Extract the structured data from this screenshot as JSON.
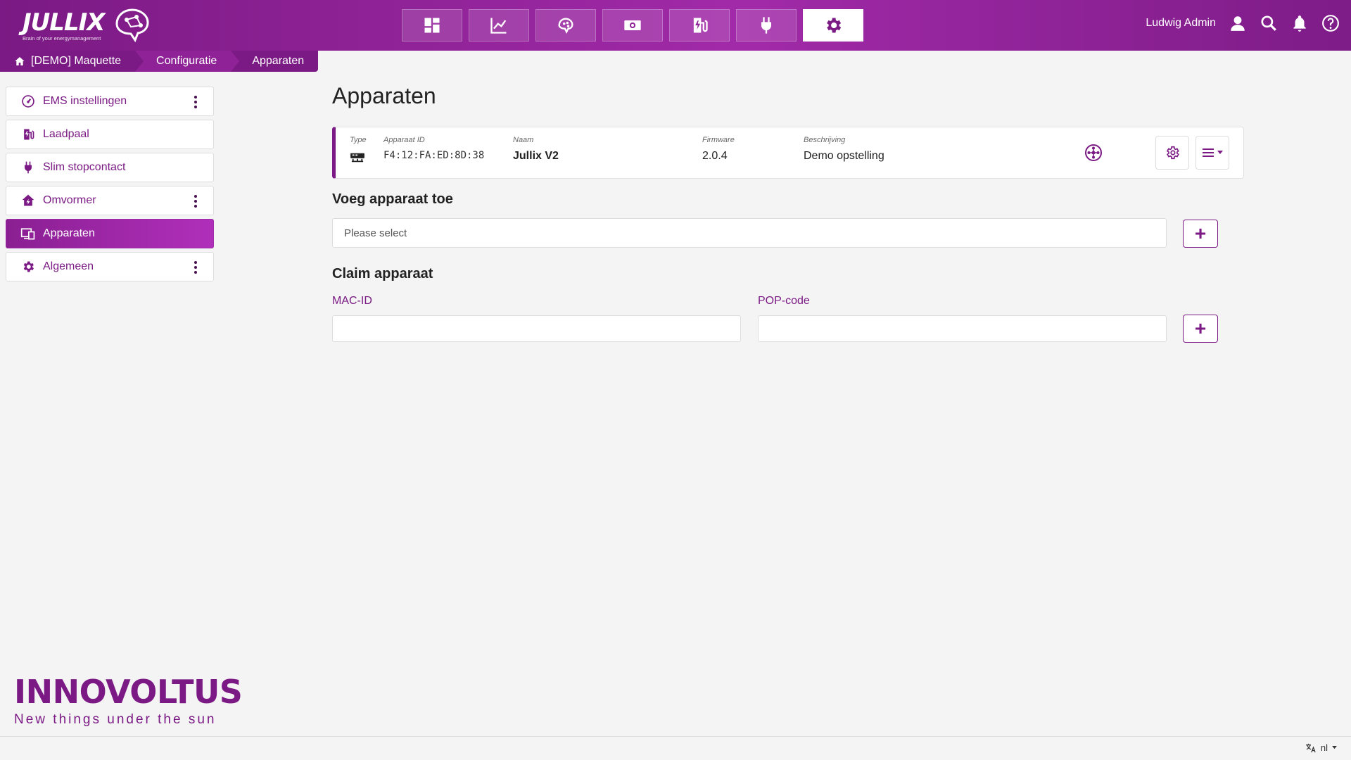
{
  "app": {
    "brand": "JULLIX",
    "tagline": "Brain of your energymanagement",
    "accent": "#7b1a84"
  },
  "topnav": [
    {
      "icon": "dashboard-icon",
      "active": false
    },
    {
      "icon": "chart-line-icon",
      "active": false
    },
    {
      "icon": "brain-icon",
      "active": false
    },
    {
      "icon": "money-icon",
      "active": false
    },
    {
      "icon": "ev-charger-icon",
      "active": false
    },
    {
      "icon": "plug-icon",
      "active": false
    },
    {
      "icon": "gear-icon",
      "active": true
    }
  ],
  "user": {
    "name": "Ludwig Admin"
  },
  "breadcrumb": {
    "home": "[DEMO] Maquette",
    "section": "Configuratie",
    "current": "Apparaten"
  },
  "sidebar": {
    "items": [
      {
        "label": "EMS instellingen",
        "icon": "gauge-icon",
        "menu": true
      },
      {
        "label": "Laadpaal",
        "icon": "ev-charger-icon",
        "menu": false
      },
      {
        "label": "Slim stopcontact",
        "icon": "plug-icon",
        "menu": false
      },
      {
        "label": "Omvormer",
        "icon": "house-bolt-icon",
        "menu": true
      },
      {
        "label": "Apparaten",
        "icon": "devices-icon",
        "menu": false,
        "active": true
      },
      {
        "label": "Algemeen",
        "icon": "gear-icon",
        "menu": true
      }
    ]
  },
  "main": {
    "title": "Apparaten",
    "device": {
      "type_label": "Type",
      "id_label": "Apparaat ID",
      "id_value": "F4:12:FA:ED:8D:38",
      "name_label": "Naam",
      "name_value": "Jullix V2",
      "firmware_label": "Firmware",
      "firmware_value": "2.0.4",
      "desc_label": "Beschrijving",
      "desc_value": "Demo opstelling"
    },
    "add_device": {
      "title": "Voeg apparaat toe",
      "placeholder": "Please select",
      "button": "+"
    },
    "claim": {
      "title": "Claim apparaat",
      "mac_label": "MAC-ID",
      "pop_label": "POP-code",
      "button": "+"
    }
  },
  "footer": {
    "brand": "INNOVOLTUS",
    "tagline": "New things under the sun",
    "language": "nl"
  }
}
